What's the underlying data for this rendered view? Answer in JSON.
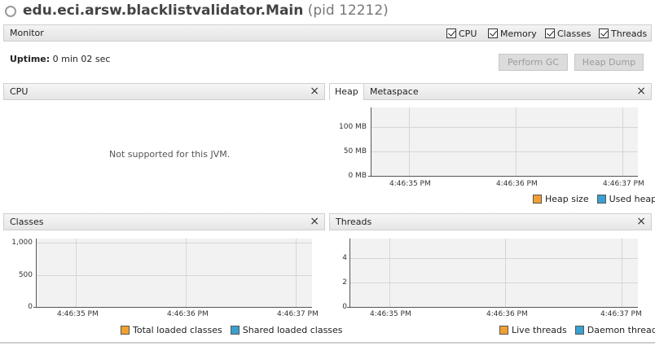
{
  "window": {
    "app_name": "edu.eci.arsw.blacklistvalidator.Main",
    "pid_text": "(pid 12212)"
  },
  "monitor": {
    "label": "Monitor",
    "checkboxes": [
      {
        "label": "CPU",
        "checked": true
      },
      {
        "label": "Memory",
        "checked": true
      },
      {
        "label": "Classes",
        "checked": true
      },
      {
        "label": "Threads",
        "checked": true
      }
    ]
  },
  "uptime": {
    "label": "Uptime:",
    "value": "0 min 02 sec"
  },
  "buttons": {
    "perform_gc": "Perform GC",
    "heap_dump": "Heap Dump"
  },
  "cpu_panel": {
    "title": "CPU",
    "message": "Not supported for this JVM."
  },
  "heap_panel": {
    "tabs": [
      "Heap",
      "Metaspace"
    ],
    "active_tab": "Heap",
    "y_ticks": [
      "100 MB",
      "50 MB",
      "0 MB"
    ],
    "x_ticks": [
      "4:46:35 PM",
      "4:46:36 PM",
      "4:46:37 PM"
    ],
    "legend": [
      {
        "label": "Heap size",
        "color": "#f0a030"
      },
      {
        "label": "Used heap",
        "color": "#3aa0d0"
      }
    ]
  },
  "classes_panel": {
    "title": "Classes",
    "y_ticks": [
      "1,000",
      "500",
      "0"
    ],
    "x_ticks": [
      "4:46:35 PM",
      "4:46:36 PM",
      "4:46:37 PM"
    ],
    "legend": [
      {
        "label": "Total loaded classes",
        "color": "#f0a030"
      },
      {
        "label": "Shared loaded classes",
        "color": "#3aa0d0"
      }
    ]
  },
  "threads_panel": {
    "title": "Threads",
    "y_ticks": [
      "4",
      "2",
      "0"
    ],
    "x_ticks": [
      "4:46:35 PM",
      "4:46:36 PM",
      "4:46:37 PM"
    ],
    "legend": [
      {
        "label": "Live threads",
        "color": "#f0a030"
      },
      {
        "label": "Daemon threads",
        "color": "#3aa0d0"
      }
    ]
  },
  "close_glyph": "×"
}
